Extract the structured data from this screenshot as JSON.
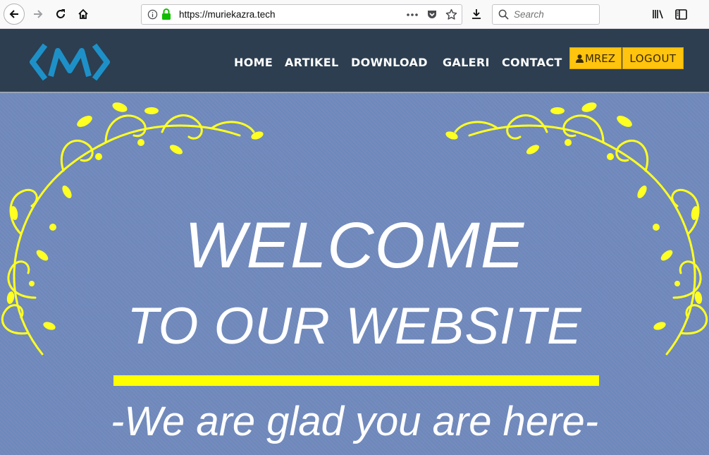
{
  "browser": {
    "url": "https://muriekazra.tech",
    "search_placeholder": "Search",
    "icons": [
      "back-icon",
      "forward-icon",
      "reload-icon",
      "home-icon",
      "info-icon",
      "lock-icon",
      "more-icon",
      "pocket-icon",
      "bookmark-star-icon",
      "download-icon",
      "search-icon",
      "library-icon",
      "sidebar-icon"
    ]
  },
  "site": {
    "nav": [
      "HOME",
      "ARTIKEL",
      "DOWNLOAD",
      "GALERI",
      "CONTACT"
    ],
    "user_label": "MREZ",
    "logout_label": "LOGOUT",
    "colors": {
      "nav_bg": "#2c3e50",
      "button": "#ffc40d",
      "logo": "#1e90c8",
      "hero_bg": "#6f88bb",
      "ornament": "#ffff00"
    }
  },
  "hero": {
    "line1": "WELCOME",
    "line2": "TO OUR WEBSITE",
    "tagline": "-We are glad you are here-"
  }
}
